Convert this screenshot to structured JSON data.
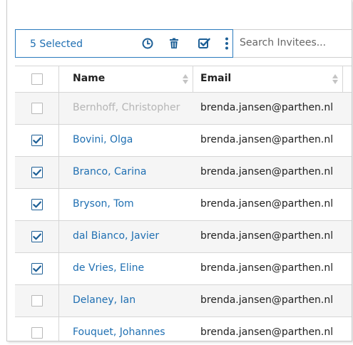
{
  "toolbar": {
    "selected_label": "5 Selected",
    "icons": [
      "history-icon",
      "trash-icon",
      "check-square-icon",
      "more-vertical-icon"
    ]
  },
  "search": {
    "placeholder": "Search Invitees..."
  },
  "table": {
    "columns": [
      "Name",
      "Email"
    ],
    "rows": [
      {
        "name": "Bernhoff, Christopher",
        "email": "brenda.jansen@parthen.nl",
        "checked": false,
        "disabled": true
      },
      {
        "name": "Bovini, Olga",
        "email": "brenda.jansen@parthen.nl",
        "checked": true,
        "disabled": false
      },
      {
        "name": "Branco, Carina",
        "email": "brenda.jansen@parthen.nl",
        "checked": true,
        "disabled": false
      },
      {
        "name": "Bryson, Tom",
        "email": "brenda.jansen@parthen.nl",
        "checked": true,
        "disabled": false
      },
      {
        "name": "dal Bianco, Javier",
        "email": "brenda.jansen@parthen.nl",
        "checked": true,
        "disabled": false
      },
      {
        "name": "de Vries, Eline",
        "email": "brenda.jansen@parthen.nl",
        "checked": true,
        "disabled": false
      },
      {
        "name": "Delaney, Ian",
        "email": "brenda.jansen@parthen.nl",
        "checked": false,
        "disabled": false
      },
      {
        "name": "Fouquet, Johannes",
        "email": "brenda.jansen@parthen.nl",
        "checked": false,
        "disabled": false
      }
    ]
  },
  "colors": {
    "accent": "#1f6fb2",
    "disabled_text": "#b5b5b5",
    "row_alt": "#f5f5f5",
    "border": "#d6d6d6"
  }
}
